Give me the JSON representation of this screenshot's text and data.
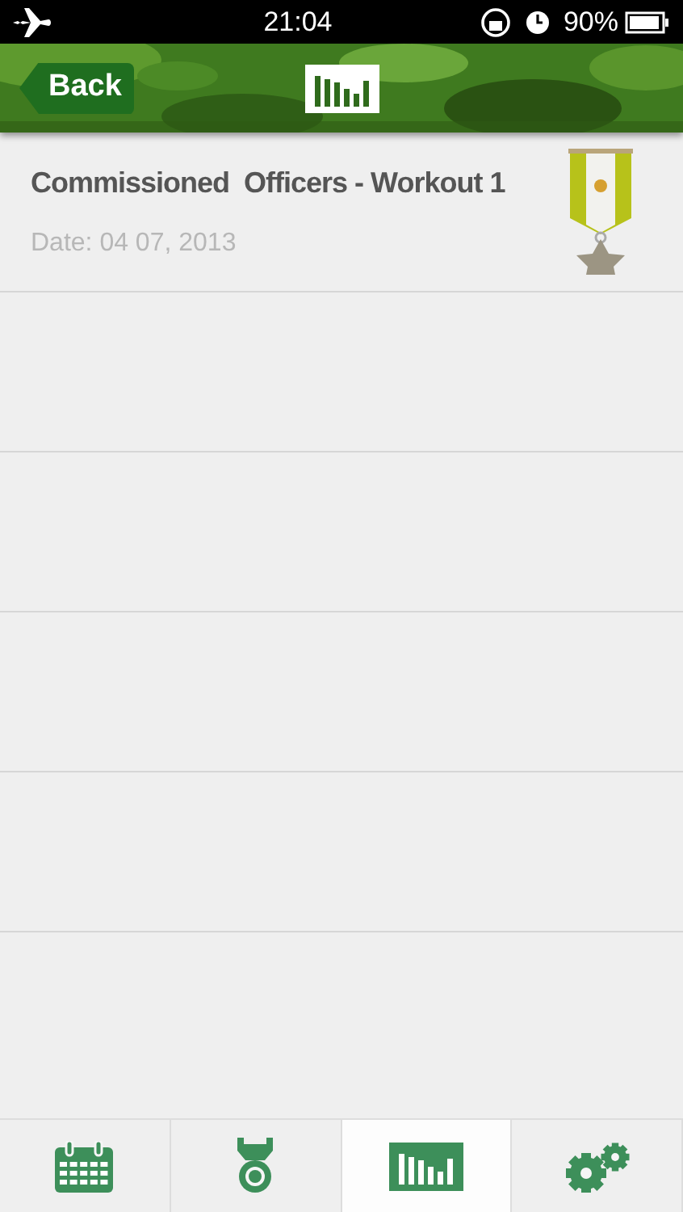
{
  "status_bar": {
    "time": "21:04",
    "battery": "90%"
  },
  "nav": {
    "back": "Back"
  },
  "workouts": [
    {
      "title": "Commissioned  Officers - Workout 1",
      "date": "Date: 04 07, 2013"
    }
  ],
  "tabs": [
    {
      "kind": "calendar",
      "selected": false
    },
    {
      "kind": "medal",
      "selected": false
    },
    {
      "kind": "chart",
      "selected": true
    },
    {
      "kind": "settings",
      "selected": false
    }
  ]
}
